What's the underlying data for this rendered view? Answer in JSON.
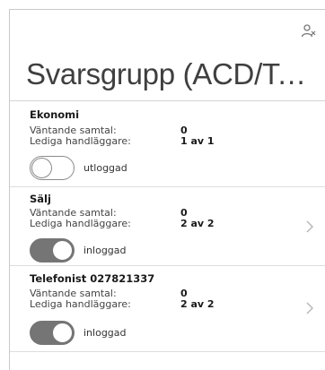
{
  "header": {
    "title": "Svarsgrupp (ACD/Telefonist)"
  },
  "groups": [
    {
      "name": "Ekonomi",
      "waiting_label": "Väntande samtal:",
      "waiting_value": "0",
      "free_label": "Lediga handläggare:",
      "free_value": "1 av 1",
      "status_label": "utloggad",
      "logged_in": false,
      "has_chevron": false
    },
    {
      "name": "Sälj",
      "waiting_label": "Väntande samtal:",
      "waiting_value": "0",
      "free_label": "Lediga handläggare:",
      "free_value": "2 av 2",
      "status_label": "inloggad",
      "logged_in": true,
      "has_chevron": true
    },
    {
      "name": "Telefonist 027821337",
      "waiting_label": "Väntande samtal:",
      "waiting_value": "0",
      "free_label": "Lediga handläggare:",
      "free_value": "2 av 2",
      "status_label": "inloggad",
      "logged_in": true,
      "has_chevron": true
    }
  ],
  "icons": {
    "header_action": "agents-icon",
    "row_action": "chevron-right-icon"
  },
  "colors": {
    "toggle_on": "#757575",
    "toggle_off_border": "#8a8a8a",
    "title": "#3f3f3f"
  }
}
